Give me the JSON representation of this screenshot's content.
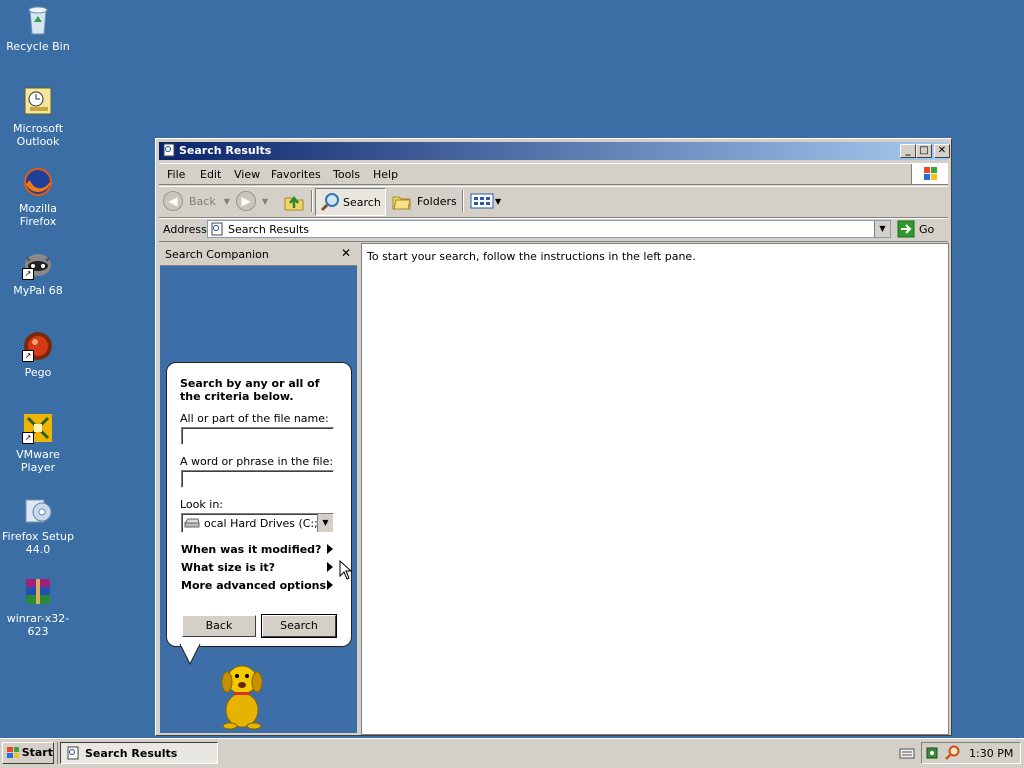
{
  "desktop": {
    "icons": [
      {
        "label": "Recycle Bin",
        "icon": "recycle-bin-icon"
      },
      {
        "label": "Microsoft Outlook",
        "icon": "outlook-icon"
      },
      {
        "label": "Mozilla Firefox",
        "icon": "firefox-icon"
      },
      {
        "label": "MyPal 68",
        "icon": "mypal-icon"
      },
      {
        "label": "Pego",
        "icon": "pego-icon"
      },
      {
        "label": "VMware Player",
        "icon": "vmware-icon"
      },
      {
        "label": "Firefox Setup 44.0",
        "icon": "firefox-setup-icon"
      },
      {
        "label": "winrar-x32-623",
        "icon": "winrar-icon"
      }
    ]
  },
  "window": {
    "title": "Search Results",
    "menu": [
      "File",
      "Edit",
      "View",
      "Favorites",
      "Tools",
      "Help"
    ],
    "toolbar": {
      "back": "Back",
      "search": "Search",
      "folders": "Folders"
    },
    "address": {
      "label": "Address",
      "value": "Search Results",
      "go": "Go"
    }
  },
  "companion": {
    "header": "Search Companion",
    "heading": "Search by any or all of the criteria below.",
    "filename_label": "All or part of the file name:",
    "filename_value": "",
    "phrase_label": "A word or phrase in the file:",
    "phrase_value": "",
    "lookin_label": "Look in:",
    "lookin_value": "ocal Hard Drives (C:;E:)",
    "options": [
      "When was it modified?",
      "What size is it?",
      "More advanced options"
    ],
    "back_button": "Back",
    "search_button": "Search"
  },
  "results": {
    "message": "To start your search, follow the instructions in the left pane."
  },
  "taskbar": {
    "start": "Start",
    "task": "Search Results",
    "clock": "1:30 PM"
  },
  "colors": {
    "desktop": "#3a6ea5",
    "titlebar": "#0a246a",
    "companion_pane": "#3d6ea8"
  }
}
